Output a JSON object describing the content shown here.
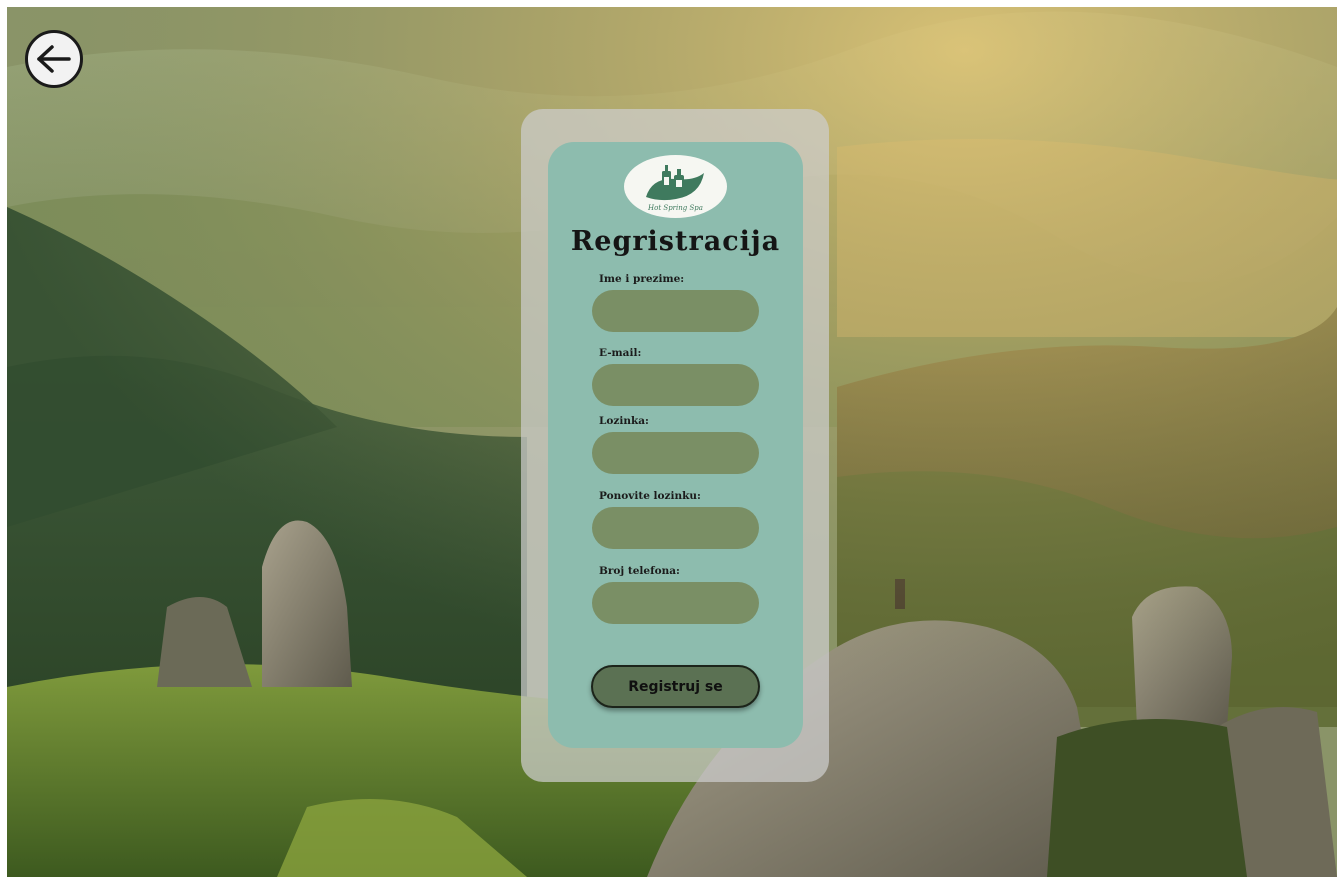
{
  "nav": {
    "back_icon": "arrow-left-icon"
  },
  "logo": {
    "text": "Hot Spring Spa",
    "icon": "spa-bottles-leaf-icon"
  },
  "form": {
    "title": "Regristracija",
    "fields": [
      {
        "label": "Ime i prezime:",
        "value": ""
      },
      {
        "label": "E-mail:",
        "value": ""
      },
      {
        "label": "Lozinka:",
        "value": ""
      },
      {
        "label": "Ponovite lozinku:",
        "value": ""
      },
      {
        "label": "Broj telefona:",
        "value": ""
      }
    ],
    "submit_label": "Registruj se"
  },
  "colors": {
    "card_outer": "#cdcdcd",
    "card_inner": "#8dbcae",
    "field": "#7a8f65",
    "button": "#5b7153",
    "brand_green": "#3f7a5e"
  }
}
